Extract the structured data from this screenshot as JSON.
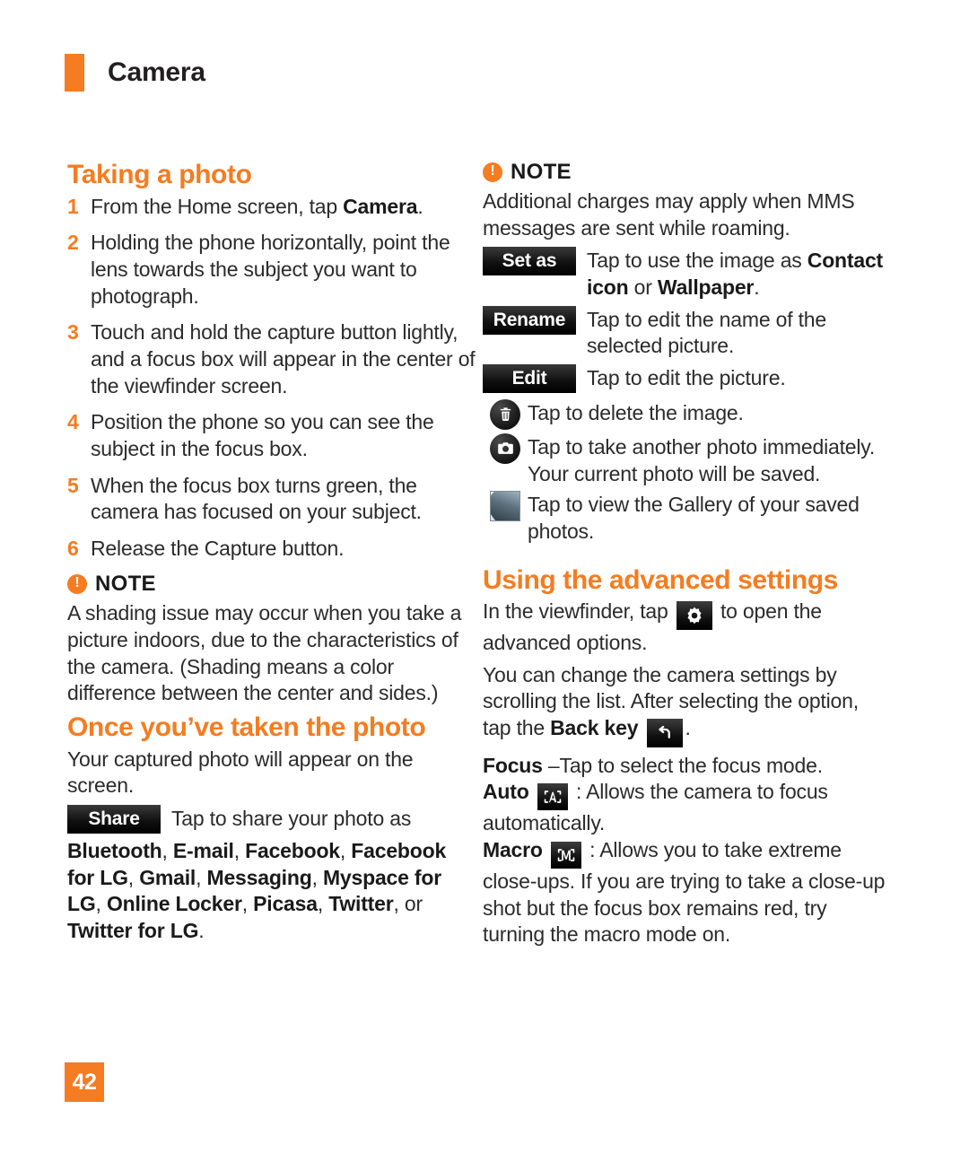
{
  "header": {
    "title": "Camera",
    "accent_color": "#F57C20"
  },
  "page_number": "42",
  "left_column": {
    "section1_title": "Taking a photo",
    "steps": [
      {
        "num": "1",
        "text_before": "From the Home screen, tap ",
        "bold": "Camera",
        "text_after": "."
      },
      {
        "num": "2",
        "text_before": "Holding the phone horizontally, point the lens towards the subject you want to photograph.",
        "bold": "",
        "text_after": ""
      },
      {
        "num": "3",
        "text_before": "Touch and hold the capture button lightly, and a focus box will appear in the center of the viewfinder screen.",
        "bold": "",
        "text_after": ""
      },
      {
        "num": "4",
        "text_before": "Position the phone so you can see the subject in the focus box.",
        "bold": "",
        "text_after": ""
      },
      {
        "num": "5",
        "text_before": "When the focus box turns green, the camera has focused on your subject.",
        "bold": "",
        "text_after": ""
      },
      {
        "num": "6",
        "text_before": "Release the Capture button.",
        "bold": "",
        "text_after": ""
      }
    ],
    "note_label": "NOTE",
    "note_body": "A shading issue may occur when you take a picture indoors, due to the characteristics of the camera. (Shading means a color difference between the center and sides.)",
    "section2_title": "Once you’ve taken the photo",
    "section2_intro": "Your captured photo will appear on the screen.",
    "share_badge": "Share",
    "share_text": "Tap to share your photo as",
    "share_apps_line1_b1": "Bluetooth",
    "share_apps_line1_b2": "E-mail",
    "share_apps_line1_b3": "Facebook",
    "share_apps_line2_b1": "Facebook for LG",
    "share_apps_line2_b2": "Gmail",
    "share_apps_line3_b1": "Messaging",
    "share_apps_line3_b2": "Myspace for LG",
    "share_apps_line4_b1": "Online Locker",
    "share_apps_line4_b2": "Picasa",
    "share_apps_line4_b3": "Twitter",
    "share_apps_line5_or": "or ",
    "share_apps_line5_b1": "Twitter for LG"
  },
  "right_column": {
    "note_label": "NOTE",
    "note_body": "Additional charges may apply when MMS messages are sent while roaming.",
    "setas_badge": "Set as",
    "setas_text_before": "Tap to use the image as ",
    "setas_bold1": "Contact icon",
    "setas_mid": " or ",
    "setas_bold2": "Wallpaper",
    "setas_after": ".",
    "rename_badge": "Rename",
    "rename_text": "Tap to edit the name of the selected picture.",
    "edit_badge": "Edit",
    "edit_text": "Tap to edit the picture.",
    "delete_icon": "trash-icon",
    "delete_text": "Tap to delete the image.",
    "camera_icon": "camera-icon",
    "camera_text": "Tap to take another photo immediately. Your current photo will be saved.",
    "gallery_icon": "gallery-thumbnail-icon",
    "gallery_text": "Tap to view the Gallery of your saved photos.",
    "section_title": "Using the advanced settings",
    "viewfinder_before": "In the viewfinder, tap ",
    "viewfinder_after": " to open the advanced options.",
    "change_settings_1": "You can change the camera settings by scrolling the list. After selecting the option, tap the ",
    "back_key_bold": "Back key",
    "change_settings_2": ".",
    "focus_bold": "Focus",
    "focus_text": " –Tap to select the focus mode.",
    "auto_bold": "Auto",
    "auto_text": " : Allows the camera to focus automatically.",
    "macro_bold": "Macro",
    "macro_text": " : Allows you to take extreme close-ups. If you are trying to take a close-up shot but the focus box remains red, try turning the macro mode on."
  }
}
